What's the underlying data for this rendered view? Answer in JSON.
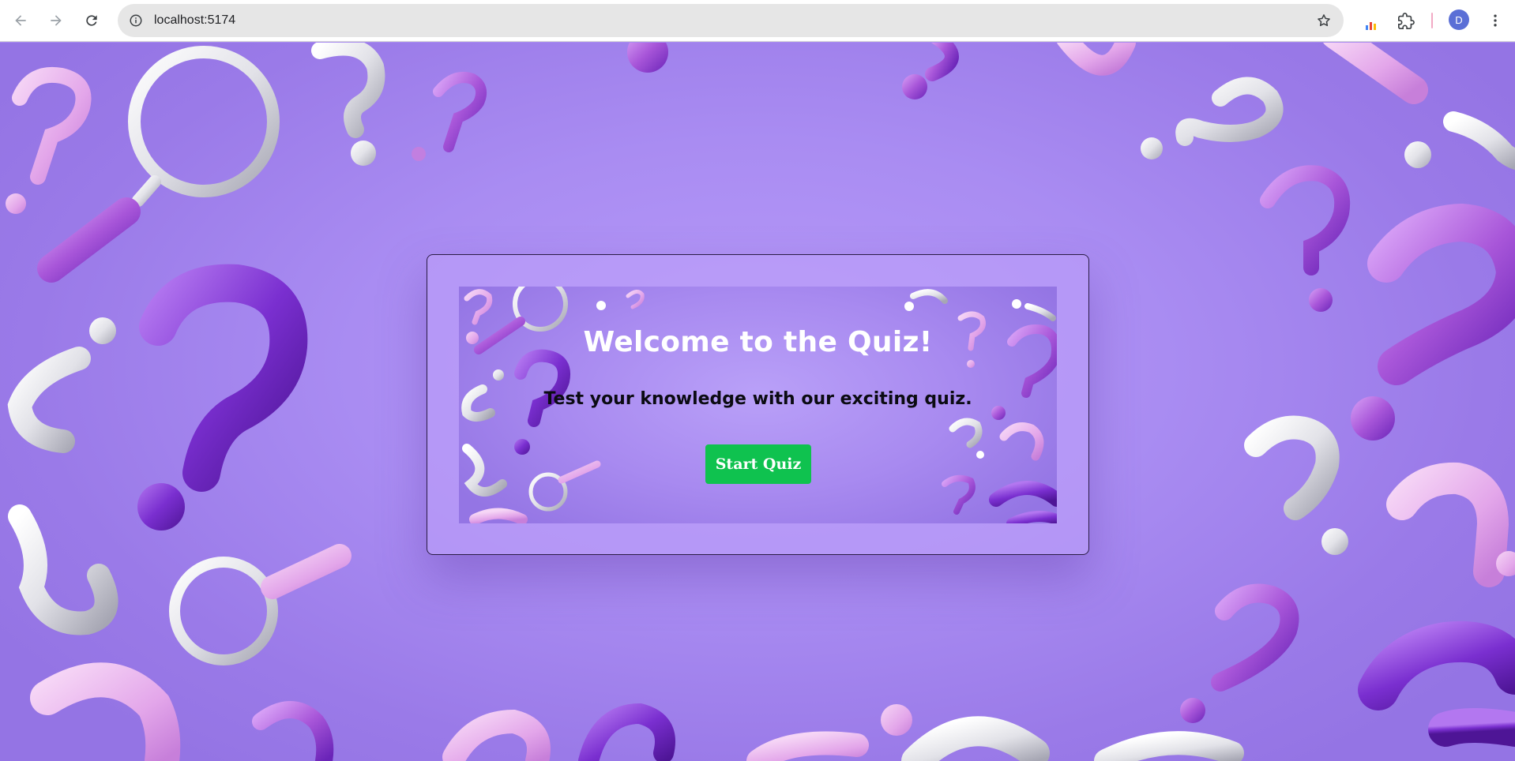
{
  "browser": {
    "url": "localhost:5174",
    "profile_initial": "D",
    "icons": {
      "back": "arrow-left-icon",
      "forward": "arrow-right-icon",
      "reload": "reload-icon",
      "site_info": "info-icon",
      "bookmark": "star-icon",
      "extension_colors": "bar-chart-extension-icon",
      "extensions": "puzzle-icon",
      "menu": "more-vert-icon"
    },
    "colors": {
      "toolbar": "#ffffff",
      "omnibox": "#e6e6e6",
      "avatar": "#5b6fd6",
      "divider": "#f2a9c4"
    }
  },
  "page": {
    "background_theme": "purple question marks and magnifying glasses",
    "colors": {
      "primary": "#a88cf0",
      "button": "#0fc24f",
      "title": "#ffffff",
      "subtitle": "#0b0b12"
    }
  },
  "quiz": {
    "title": "Welcome to the Quiz!",
    "subtitle": "Test your knowledge with our exciting quiz.",
    "start_button": "Start Quiz"
  }
}
